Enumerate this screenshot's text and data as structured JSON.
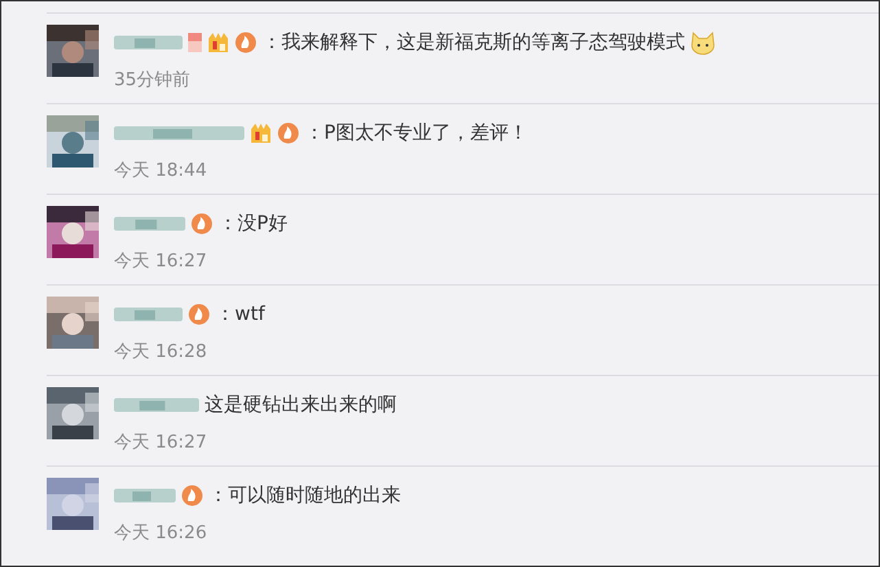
{
  "comments": [
    {
      "badges": [
        {
          "kind": "tag"
        },
        {
          "kind": "vip"
        },
        {
          "kind": "level"
        }
      ],
      "text": "：我来解释下，这是新福克斯的等离子态驾驶模式",
      "emoji": true,
      "time": "35分钟前"
    },
    {
      "badges": [
        {
          "kind": "vip"
        },
        {
          "kind": "level"
        }
      ],
      "text": "：P图太不专业了，差评！",
      "emoji": false,
      "time": "今天 18:44"
    },
    {
      "badges": [
        {
          "kind": "level"
        }
      ],
      "text": "：没P好",
      "emoji": false,
      "time": "今天 16:27"
    },
    {
      "badges": [
        {
          "kind": "level"
        }
      ],
      "text": "：wtf",
      "emoji": false,
      "time": "今天 16:28"
    },
    {
      "text": "这是硬钻出来出来的啊",
      "emoji": false,
      "time": "今天 16:27"
    },
    {
      "badges": [
        {
          "kind": "level"
        }
      ],
      "text": "：可以随时随地的出来",
      "emoji": false,
      "time": "今天 16:26"
    }
  ]
}
